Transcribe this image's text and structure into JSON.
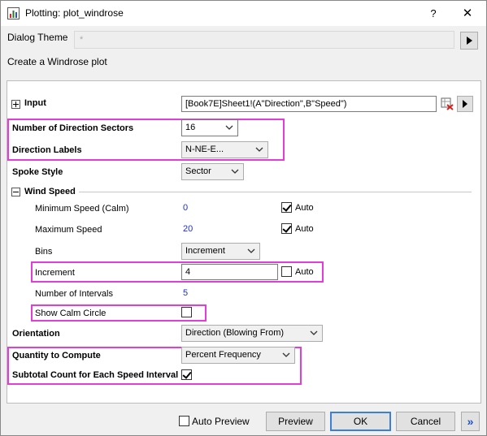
{
  "window": {
    "title": "Plotting: plot_windrose",
    "help_label": "?",
    "close_label": "✕"
  },
  "theme": {
    "label": "Dialog Theme",
    "value": "*"
  },
  "description": "Create a Windrose plot",
  "input": {
    "label": "Input",
    "value": "[Book7E]Sheet1!(A\"Direction\",B\"Speed\")"
  },
  "sectors": {
    "label": "Number of Direction Sectors",
    "value": "16"
  },
  "direction_labels": {
    "label": "Direction Labels",
    "value": "N-NE-E..."
  },
  "spoke_style": {
    "label": "Spoke Style",
    "value": "Sector"
  },
  "wind_speed": {
    "label": "Wind Speed",
    "min_speed": {
      "label": "Minimum Speed (Calm)",
      "value": "0",
      "auto_label": "Auto",
      "auto_checked": true
    },
    "max_speed": {
      "label": "Maximum Speed",
      "value": "20",
      "auto_label": "Auto",
      "auto_checked": true
    },
    "bins": {
      "label": "Bins",
      "value": "Increment"
    },
    "increment": {
      "label": "Increment",
      "value": "4",
      "auto_label": "Auto",
      "auto_checked": false
    },
    "intervals": {
      "label": "Number of Intervals",
      "value": "5"
    },
    "calm_circle": {
      "label": "Show Calm Circle",
      "checked": false
    }
  },
  "orientation": {
    "label": "Orientation",
    "value": "Direction (Blowing From)"
  },
  "quantity": {
    "label": "Quantity to Compute",
    "value": "Percent Frequency"
  },
  "subtotal": {
    "label": "Subtotal Count for Each Speed Interval",
    "checked": true
  },
  "footer": {
    "auto_preview_label": "Auto Preview",
    "auto_preview_checked": false,
    "preview_label": "Preview",
    "ok_label": "OK",
    "cancel_label": "Cancel",
    "expand_label": "»"
  },
  "colors": {
    "highlight": "#e23dd8",
    "value_blue": "#1c2fd6",
    "default_button_border": "#3c7fd6"
  }
}
